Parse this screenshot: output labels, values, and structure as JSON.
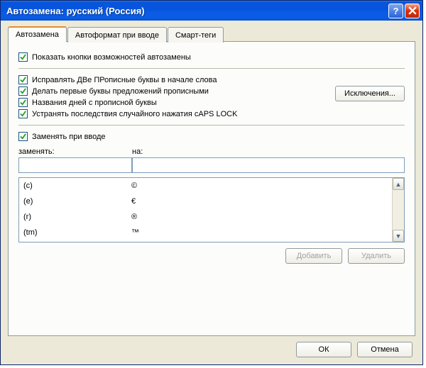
{
  "window": {
    "title": "Автозамена: русский (Россия)"
  },
  "tabs": [
    {
      "label": "Автозамена",
      "active": true
    },
    {
      "label": "Автоформат при вводе",
      "active": false
    },
    {
      "label": "Смарт-теги",
      "active": false
    }
  ],
  "options": {
    "show_autocorrect_options": {
      "label": "Показать кнопки возможностей автозамены",
      "checked": true
    },
    "correct_two_caps": {
      "label": "Исправлять ДВе ПРописные буквы в начале слова",
      "checked": true
    },
    "capitalize_sentences": {
      "label": "Делать первые буквы предложений прописными",
      "checked": true
    },
    "capitalize_days": {
      "label": "Названия дней с прописной буквы",
      "checked": true
    },
    "correct_capslock": {
      "label": "Устранять последствия случайного нажатия cAPS LOCK",
      "checked": true
    },
    "replace_as_type": {
      "label": "Заменять при вводе",
      "checked": true
    }
  },
  "exceptions_button": "Исключения...",
  "columns": {
    "replace": "заменять:",
    "with": "на:"
  },
  "inputs": {
    "replace_value": "",
    "with_value": ""
  },
  "entries": [
    {
      "from": "(c)",
      "to": "©"
    },
    {
      "from": "(e)",
      "to": "€"
    },
    {
      "from": "(r)",
      "to": "®"
    },
    {
      "from": "(tm)",
      "to": "™"
    }
  ],
  "action_buttons": {
    "add": "Добавить",
    "delete": "Удалить"
  },
  "dialog_buttons": {
    "ok": "ОК",
    "cancel": "Отмена"
  }
}
